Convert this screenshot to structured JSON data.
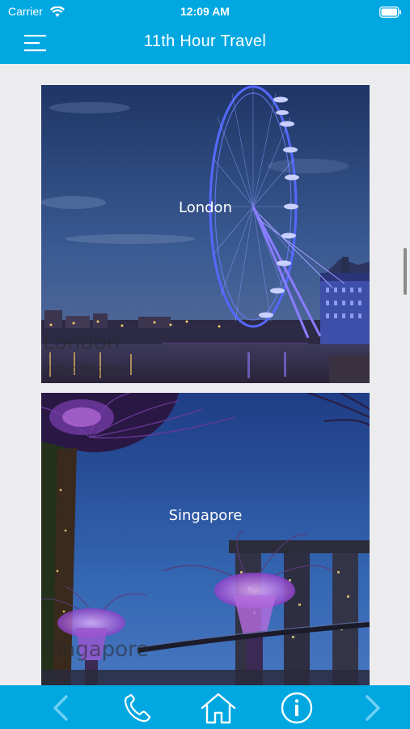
{
  "status_bar": {
    "carrier": "Carrier",
    "time": "12:09 AM",
    "wifi_icon": "wifi-icon",
    "battery_icon": "battery-icon"
  },
  "header": {
    "title": "11th Hour Travel",
    "menu_icon": "hamburger-menu-icon",
    "background": "#00a7e1"
  },
  "destinations": [
    {
      "name": "London",
      "ghost_name": "London",
      "ghost_country": "United Kingdom"
    },
    {
      "name": "Singapore",
      "ghost_name": "Singapore"
    }
  ],
  "tab_bar": {
    "background": "#00a7e1",
    "items": [
      "back-arrow-icon",
      "phone-icon",
      "home-icon",
      "info-icon",
      "forward-arrow-icon"
    ]
  }
}
